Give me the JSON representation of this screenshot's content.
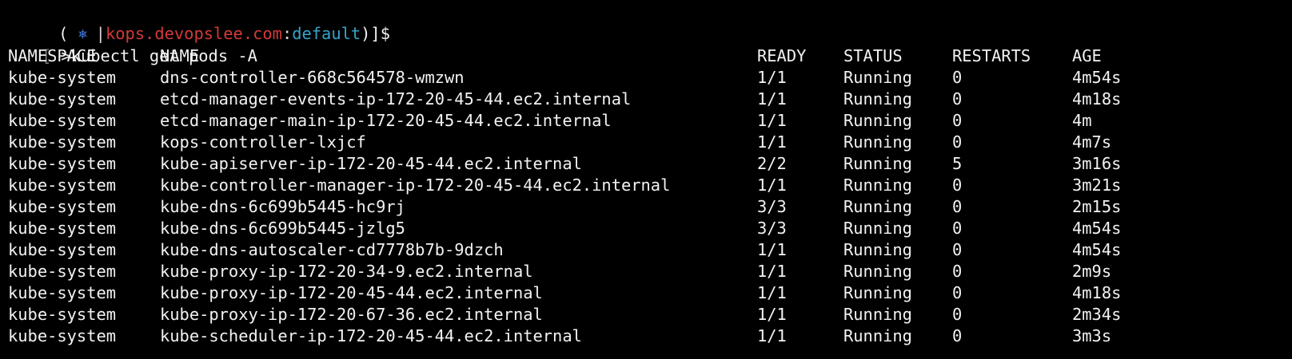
{
  "prompt": {
    "open": "(",
    "icon": "kubernetes-wheel-icon",
    "icon_glyph": "⎈",
    "bar": "|",
    "context": "kops.devopslee.com",
    "colon": ":",
    "namespace": "default",
    "close": ")]$"
  },
  "command": {
    "bracket": "[",
    "prompt_char": ">",
    "text": "kubectl get pods -A"
  },
  "colors": {
    "background": "#000000",
    "text": "#f2f2f2",
    "context": "#d23a3a",
    "namespace": "#37a3c9",
    "icon": "#3b6ec9"
  },
  "table": {
    "headers": {
      "namespace": "NAMESPACE",
      "name": "NAME",
      "ready": "READY",
      "status": "STATUS",
      "restarts": "RESTARTS",
      "age": "AGE"
    },
    "rows": [
      {
        "namespace": "kube-system",
        "name": "dns-controller-668c564578-wmzwn",
        "ready": "1/1",
        "status": "Running",
        "restarts": "0",
        "age": "4m54s"
      },
      {
        "namespace": "kube-system",
        "name": "etcd-manager-events-ip-172-20-45-44.ec2.internal",
        "ready": "1/1",
        "status": "Running",
        "restarts": "0",
        "age": "4m18s"
      },
      {
        "namespace": "kube-system",
        "name": "etcd-manager-main-ip-172-20-45-44.ec2.internal",
        "ready": "1/1",
        "status": "Running",
        "restarts": "0",
        "age": "4m"
      },
      {
        "namespace": "kube-system",
        "name": "kops-controller-lxjcf",
        "ready": "1/1",
        "status": "Running",
        "restarts": "0",
        "age": "4m7s"
      },
      {
        "namespace": "kube-system",
        "name": "kube-apiserver-ip-172-20-45-44.ec2.internal",
        "ready": "2/2",
        "status": "Running",
        "restarts": "5",
        "age": "3m16s"
      },
      {
        "namespace": "kube-system",
        "name": "kube-controller-manager-ip-172-20-45-44.ec2.internal",
        "ready": "1/1",
        "status": "Running",
        "restarts": "0",
        "age": "3m21s"
      },
      {
        "namespace": "kube-system",
        "name": "kube-dns-6c699b5445-hc9rj",
        "ready": "3/3",
        "status": "Running",
        "restarts": "0",
        "age": "2m15s"
      },
      {
        "namespace": "kube-system",
        "name": "kube-dns-6c699b5445-jzlg5",
        "ready": "3/3",
        "status": "Running",
        "restarts": "0",
        "age": "4m54s"
      },
      {
        "namespace": "kube-system",
        "name": "kube-dns-autoscaler-cd7778b7b-9dzch",
        "ready": "1/1",
        "status": "Running",
        "restarts": "0",
        "age": "4m54s"
      },
      {
        "namespace": "kube-system",
        "name": "kube-proxy-ip-172-20-34-9.ec2.internal",
        "ready": "1/1",
        "status": "Running",
        "restarts": "0",
        "age": "2m9s"
      },
      {
        "namespace": "kube-system",
        "name": "kube-proxy-ip-172-20-45-44.ec2.internal",
        "ready": "1/1",
        "status": "Running",
        "restarts": "0",
        "age": "4m18s"
      },
      {
        "namespace": "kube-system",
        "name": "kube-proxy-ip-172-20-67-36.ec2.internal",
        "ready": "1/1",
        "status": "Running",
        "restarts": "0",
        "age": "2m34s"
      },
      {
        "namespace": "kube-system",
        "name": "kube-scheduler-ip-172-20-45-44.ec2.internal",
        "ready": "1/1",
        "status": "Running",
        "restarts": "0",
        "age": "3m3s"
      }
    ]
  }
}
